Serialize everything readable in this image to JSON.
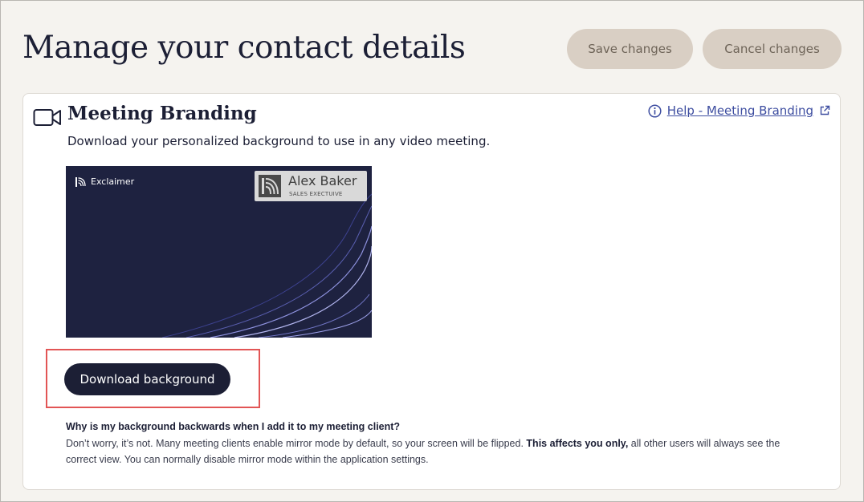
{
  "header": {
    "title": "Manage your contact details",
    "save_label": "Save changes",
    "cancel_label": "Cancel changes"
  },
  "card": {
    "title": "Meeting Branding",
    "icon": "video-camera-icon",
    "help_label": "Help - Meeting Branding",
    "subtitle": "Download your personalized background to use in any video meeting.",
    "preview": {
      "brand": "Exclaimer",
      "name": "Alex Baker",
      "role": "SALES EXECTUIVE"
    },
    "download_label": "Download background",
    "faq": {
      "question": "Why is my background backwards when I add it to my meeting client?",
      "answer_before": "Don’t worry, it’s not. Many meeting clients enable mirror mode by default, so your screen will be flipped. ",
      "answer_bold": "This affects you only,",
      "answer_after": " all other users will always see the correct view. You can normally disable mirror mode within the application settings."
    }
  },
  "colors": {
    "page_bg": "#f5f3ef",
    "primary": "#1c1f35",
    "pill_bg": "#d9cfc4",
    "link": "#3d4da0",
    "highlight": "#e25555"
  }
}
